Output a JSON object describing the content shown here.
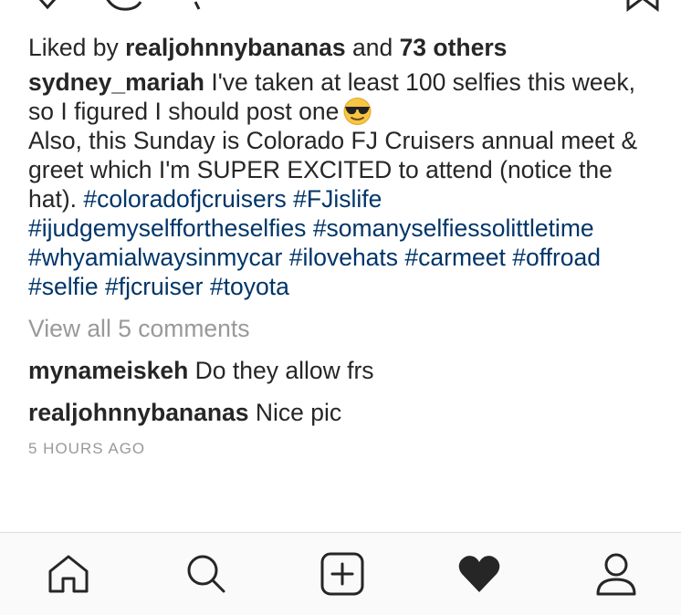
{
  "post": {
    "likes": {
      "prefix": "Liked by",
      "user": "realjohnnybananas",
      "conjunction": "and",
      "others": "73 others"
    },
    "caption": {
      "author": "sydney_mariah",
      "line1": " I've taken at least 100 selfies this week, so I figured I should post one",
      "emoji": "sunglasses-emoji",
      "line2": "Also, this Sunday is Colorado FJ Cruisers annual meet & greet which I'm SUPER EXCITED to attend (notice the hat). ",
      "hashtags": [
        "#coloradofjcruisers",
        "#FJislife",
        "#ijudgemyselffortheselfies",
        "#somanyselfiessolittletime",
        "#whyamialwaysinmycar",
        "#ilovehats",
        "#carmeet",
        "#offroad",
        "#selfie",
        "#fjcruiser",
        "#toyota"
      ]
    },
    "view_all_comments": "View all 5 comments",
    "comments": [
      {
        "user": "mynameiskeh",
        "text": "Do they allow frs"
      },
      {
        "user": "realjohnnybananas",
        "text": "Nice pic"
      }
    ],
    "timestamp": "5 HOURS AGO"
  },
  "tabbar": {
    "items": [
      {
        "icon": "home-icon"
      },
      {
        "icon": "search-icon"
      },
      {
        "icon": "add-post-icon"
      },
      {
        "icon": "heart-icon"
      },
      {
        "icon": "profile-icon"
      }
    ]
  },
  "colors": {
    "text": "#262626",
    "hashtag": "#003569",
    "muted": "#999999",
    "tabbar_bg": "#fafafa"
  }
}
